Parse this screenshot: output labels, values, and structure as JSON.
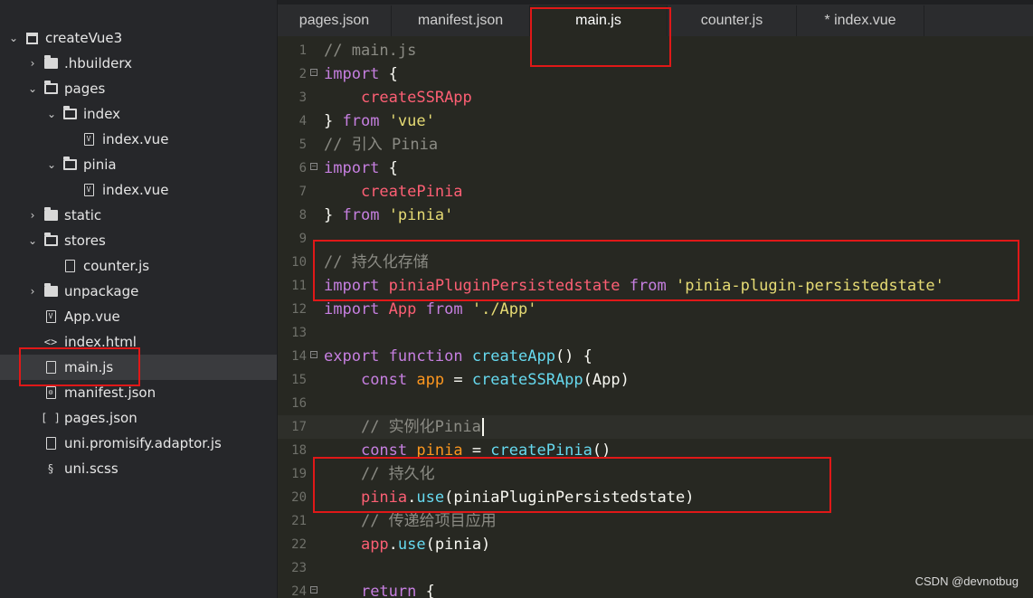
{
  "sidebar": {
    "items": [
      {
        "label": "createVue3",
        "depth": 0,
        "chevron": "⌄",
        "icon": "project-icon",
        "selected": false
      },
      {
        "label": ".hbuilderx",
        "depth": 1,
        "chevron": "›",
        "icon": "folder-icon",
        "selected": false
      },
      {
        "label": "pages",
        "depth": 1,
        "chevron": "⌄",
        "icon": "folder-open-icon",
        "selected": false
      },
      {
        "label": "index",
        "depth": 2,
        "chevron": "⌄",
        "icon": "folder-open-icon",
        "selected": false
      },
      {
        "label": "index.vue",
        "depth": 3,
        "chevron": "",
        "icon": "vue-file-icon",
        "selected": false
      },
      {
        "label": "pinia",
        "depth": 2,
        "chevron": "⌄",
        "icon": "folder-open-icon",
        "selected": false
      },
      {
        "label": "index.vue",
        "depth": 3,
        "chevron": "",
        "icon": "vue-file-icon",
        "selected": false
      },
      {
        "label": "static",
        "depth": 1,
        "chevron": "›",
        "icon": "folder-icon",
        "selected": false
      },
      {
        "label": "stores",
        "depth": 1,
        "chevron": "⌄",
        "icon": "folder-open-icon",
        "selected": false
      },
      {
        "label": "counter.js",
        "depth": 2,
        "chevron": "",
        "icon": "js-file-icon",
        "selected": false
      },
      {
        "label": "unpackage",
        "depth": 1,
        "chevron": "›",
        "icon": "folder-icon",
        "selected": false
      },
      {
        "label": "App.vue",
        "depth": 1,
        "chevron": "",
        "icon": "vue-file-icon",
        "selected": false
      },
      {
        "label": "index.html",
        "depth": 1,
        "chevron": "",
        "icon": "html-file-icon",
        "selected": false
      },
      {
        "label": "main.js",
        "depth": 1,
        "chevron": "",
        "icon": "js-file-icon",
        "selected": true
      },
      {
        "label": "manifest.json",
        "depth": 1,
        "chevron": "",
        "icon": "settings-file-icon",
        "selected": false
      },
      {
        "label": "pages.json",
        "depth": 1,
        "chevron": "",
        "icon": "json-file-icon",
        "selected": false
      },
      {
        "label": "uni.promisify.adaptor.js",
        "depth": 1,
        "chevron": "",
        "icon": "js-file-icon",
        "selected": false
      },
      {
        "label": "uni.scss",
        "depth": 1,
        "chevron": "",
        "icon": "scss-file-icon",
        "selected": false
      }
    ]
  },
  "tabs": [
    {
      "label": "pages.json",
      "active": false
    },
    {
      "label": "manifest.json",
      "active": false
    },
    {
      "label": "main.js",
      "active": true
    },
    {
      "label": "counter.js",
      "active": false
    },
    {
      "label": "* index.vue",
      "active": false
    }
  ],
  "editor": {
    "current_line": 17,
    "lines": [
      {
        "n": "1",
        "fold": false,
        "tokens": [
          [
            "cmt",
            "// main.js"
          ]
        ]
      },
      {
        "n": "2",
        "fold": true,
        "tokens": [
          [
            "kw2",
            "import"
          ],
          [
            "plain",
            " {"
          ]
        ]
      },
      {
        "n": "3",
        "fold": false,
        "tokens": [
          [
            "plain",
            "    "
          ],
          [
            "id",
            "createSSRApp"
          ]
        ]
      },
      {
        "n": "4",
        "fold": false,
        "tokens": [
          [
            "plain",
            "} "
          ],
          [
            "kw2",
            "from"
          ],
          [
            "plain",
            " "
          ],
          [
            "str",
            "'vue'"
          ]
        ]
      },
      {
        "n": "5",
        "fold": false,
        "tokens": [
          [
            "cmt",
            "// 引入 Pinia"
          ]
        ]
      },
      {
        "n": "6",
        "fold": true,
        "tokens": [
          [
            "kw2",
            "import"
          ],
          [
            "plain",
            " {"
          ]
        ]
      },
      {
        "n": "7",
        "fold": false,
        "tokens": [
          [
            "plain",
            "    "
          ],
          [
            "id",
            "createPinia"
          ]
        ]
      },
      {
        "n": "8",
        "fold": false,
        "tokens": [
          [
            "plain",
            "} "
          ],
          [
            "kw2",
            "from"
          ],
          [
            "plain",
            " "
          ],
          [
            "str",
            "'pinia'"
          ]
        ]
      },
      {
        "n": "9",
        "fold": false,
        "tokens": []
      },
      {
        "n": "10",
        "fold": false,
        "tokens": [
          [
            "cmt",
            "// 持久化存储"
          ]
        ]
      },
      {
        "n": "11",
        "fold": false,
        "tokens": [
          [
            "kw2",
            "import"
          ],
          [
            "plain",
            " "
          ],
          [
            "id",
            "piniaPluginPersistedstate"
          ],
          [
            "plain",
            " "
          ],
          [
            "kw2",
            "from"
          ],
          [
            "plain",
            " "
          ],
          [
            "str",
            "'pinia-plugin-persistedstate'"
          ]
        ]
      },
      {
        "n": "12",
        "fold": false,
        "tokens": [
          [
            "kw2",
            "import"
          ],
          [
            "plain",
            " "
          ],
          [
            "id",
            "App"
          ],
          [
            "plain",
            " "
          ],
          [
            "kw2",
            "from"
          ],
          [
            "plain",
            " "
          ],
          [
            "str",
            "'./App'"
          ]
        ]
      },
      {
        "n": "13",
        "fold": false,
        "tokens": []
      },
      {
        "n": "14",
        "fold": true,
        "tokens": [
          [
            "kw2",
            "export"
          ],
          [
            "plain",
            " "
          ],
          [
            "kw2",
            "function"
          ],
          [
            "plain",
            " "
          ],
          [
            "fn",
            "createApp"
          ],
          [
            "plain",
            "() {"
          ]
        ]
      },
      {
        "n": "15",
        "fold": false,
        "tokens": [
          [
            "plain",
            "    "
          ],
          [
            "kw2",
            "const"
          ],
          [
            "plain",
            " "
          ],
          [
            "var",
            "app"
          ],
          [
            "plain",
            " = "
          ],
          [
            "fn",
            "createSSRApp"
          ],
          [
            "plain",
            "(App)"
          ]
        ]
      },
      {
        "n": "16",
        "fold": false,
        "tokens": []
      },
      {
        "n": "17",
        "fold": false,
        "tokens": [
          [
            "plain",
            "    "
          ],
          [
            "cmt",
            "// 实例化Pinia"
          ]
        ],
        "caret": true
      },
      {
        "n": "18",
        "fold": false,
        "tokens": [
          [
            "plain",
            "    "
          ],
          [
            "kw2",
            "const"
          ],
          [
            "plain",
            " "
          ],
          [
            "var",
            "pinia"
          ],
          [
            "plain",
            " = "
          ],
          [
            "fn",
            "createPinia"
          ],
          [
            "plain",
            "()"
          ]
        ]
      },
      {
        "n": "19",
        "fold": false,
        "tokens": [
          [
            "plain",
            "    "
          ],
          [
            "cmt",
            "// 持久化"
          ]
        ]
      },
      {
        "n": "20",
        "fold": false,
        "tokens": [
          [
            "plain",
            "    "
          ],
          [
            "id",
            "pinia"
          ],
          [
            "plain",
            "."
          ],
          [
            "fn",
            "use"
          ],
          [
            "plain",
            "(piniaPluginPersistedstate)"
          ]
        ]
      },
      {
        "n": "21",
        "fold": false,
        "tokens": [
          [
            "plain",
            "    "
          ],
          [
            "cmt",
            "// 传递给项目应用"
          ]
        ]
      },
      {
        "n": "22",
        "fold": false,
        "tokens": [
          [
            "plain",
            "    "
          ],
          [
            "id",
            "app"
          ],
          [
            "plain",
            "."
          ],
          [
            "fn",
            "use"
          ],
          [
            "plain",
            "(pinia)"
          ]
        ]
      },
      {
        "n": "23",
        "fold": false,
        "tokens": []
      },
      {
        "n": "24",
        "fold": true,
        "tokens": [
          [
            "plain",
            "    "
          ],
          [
            "kw2",
            "return"
          ],
          [
            "plain",
            " {"
          ]
        ]
      }
    ]
  },
  "watermark": "CSDN @devnotbug",
  "colors": {
    "annotation": "#e01818",
    "background": "#272822",
    "sidebar": "#26272a"
  }
}
